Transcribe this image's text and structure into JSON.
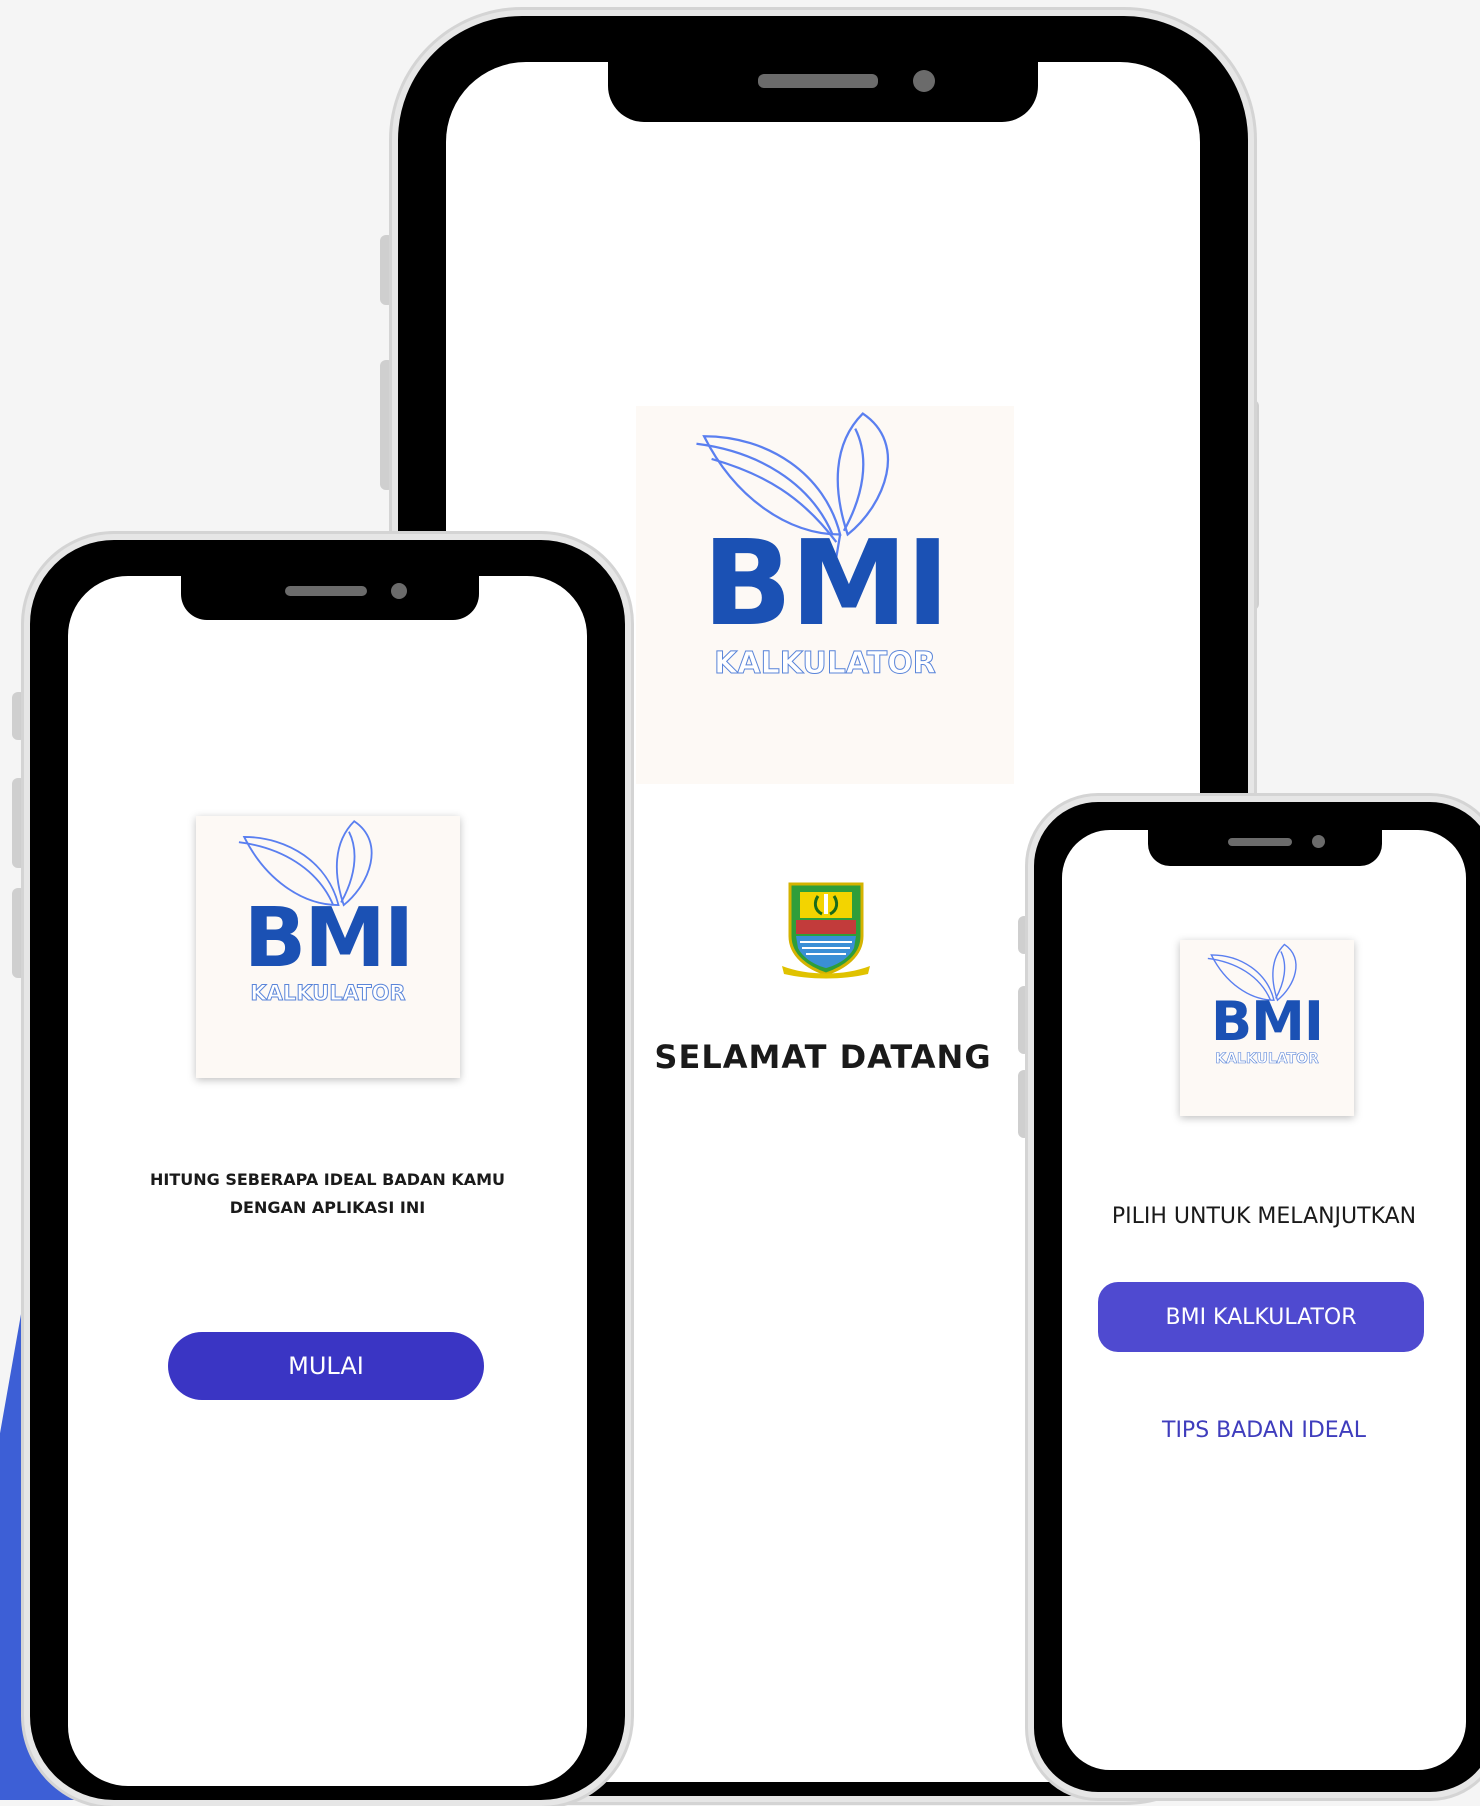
{
  "brand": {
    "logo_main": "BMI",
    "logo_sub": "KALKULATOR",
    "primary_color": "#3a35c4",
    "logo_color": "#1b51b4"
  },
  "splash_screen": {
    "welcome_text": "SELAMAT DATANG",
    "emblem_icon": "regional-emblem-icon"
  },
  "intro_screen": {
    "description_line1": "HITUNG SEBERAPA IDEAL BADAN KAMU",
    "description_line2": "DENGAN APLIKASI INI",
    "start_button": "MULAI"
  },
  "menu_screen": {
    "prompt": "PILIH UNTUK MELANJUTKAN",
    "calculator_button": "BMI KALKULATOR",
    "tips_link": "TIPS BADAN IDEAL"
  }
}
